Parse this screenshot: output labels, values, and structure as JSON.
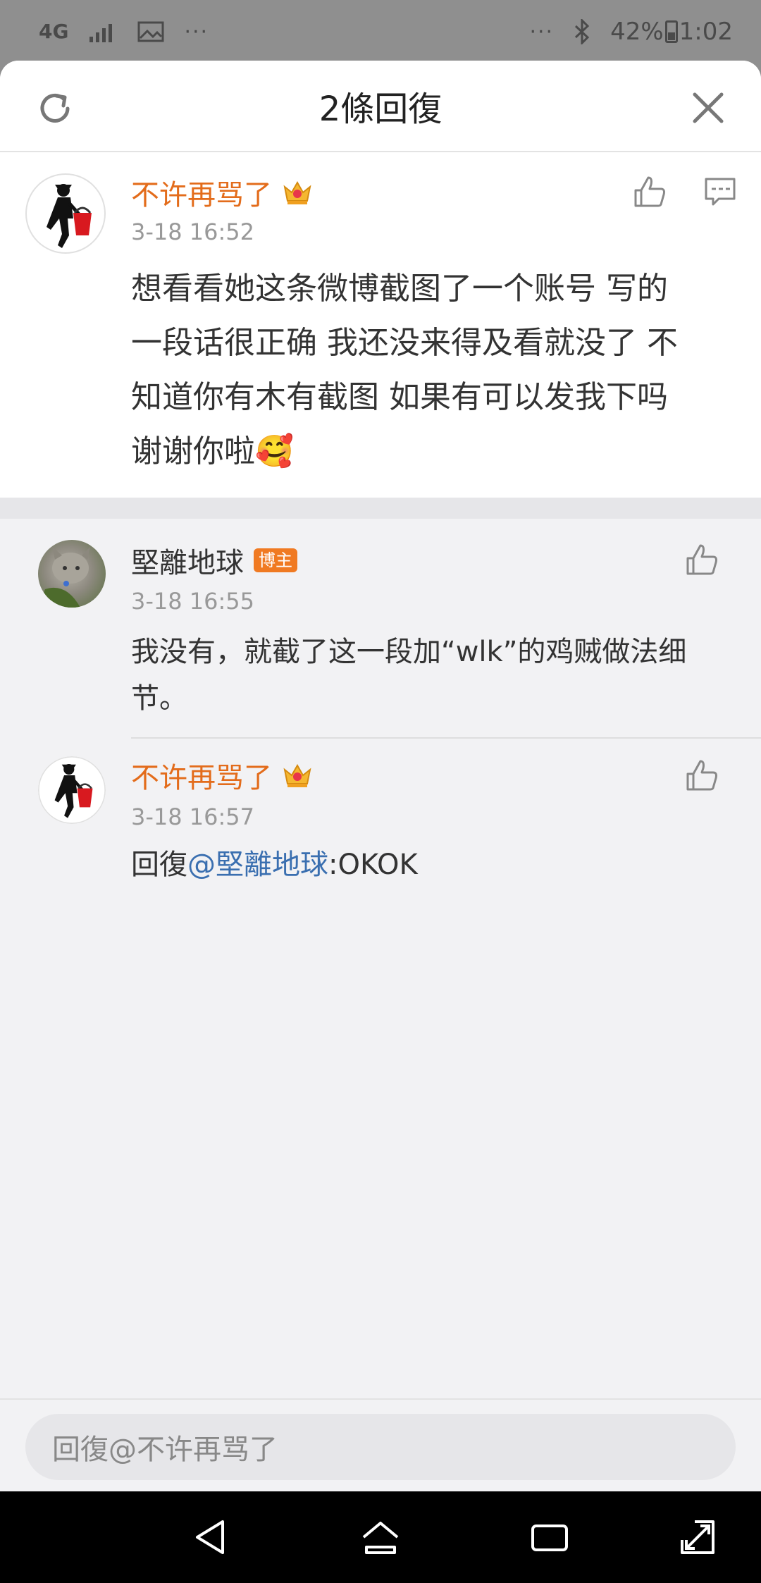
{
  "status_bar": {
    "network": "4G",
    "more": "···",
    "more_right": "···",
    "battery": "42%",
    "time": "1:02"
  },
  "header": {
    "title": "2條回復"
  },
  "main_comment": {
    "username": "不许再骂了",
    "time": "3-18 16:52",
    "lines": [
      "想看看她这条微博截图了一个账号 写的",
      "一段话很正确 我还没来得及看就没了 不",
      "知道你有木有截图 如果有可以发我下吗",
      "谢谢你啦"
    ],
    "emoji": "🥰"
  },
  "replies": [
    {
      "username": "堅離地球",
      "badge": "博主",
      "time": "3-18 16:55",
      "lines": [
        "我没有，就截了这一段加“wlk”的鸡贼做法细",
        "节。"
      ]
    },
    {
      "username": "不许再骂了",
      "time": "3-18 16:57",
      "prefix": "回復",
      "mention": "@堅離地球",
      "suffix": ":OKOK"
    }
  ],
  "input": {
    "placeholder": "回復@不许再骂了"
  },
  "colors": {
    "username_orange": "#e36c1b",
    "mention_blue": "#3a6fb0",
    "badge_orange": "#f07a22"
  }
}
